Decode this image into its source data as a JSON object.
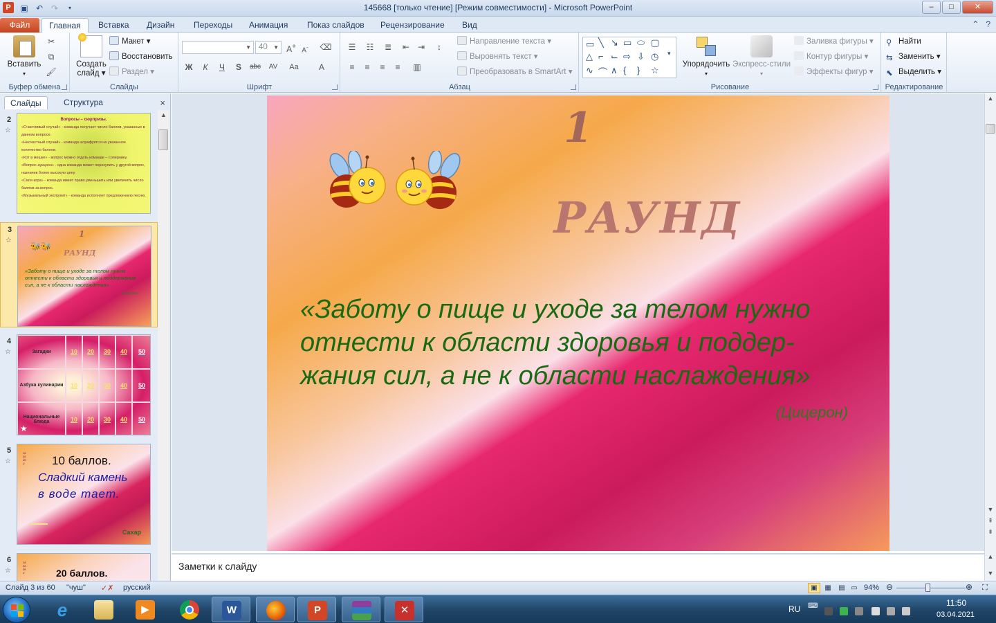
{
  "window": {
    "title": "145668 [только чтение] [Режим совместимости]  -  Microsoft PowerPoint",
    "app_icon": "P",
    "qat": [
      "save-icon",
      "undo-icon",
      "redo-icon"
    ],
    "controls": [
      "–",
      "□",
      "✕"
    ]
  },
  "tabs": {
    "file": "Файл",
    "items": [
      "Главная",
      "Вставка",
      "Дизайн",
      "Переходы",
      "Анимация",
      "Показ слайдов",
      "Рецензирование",
      "Вид"
    ],
    "active_index": 0
  },
  "ribbon": {
    "clipboard": {
      "label": "Буфер обмена",
      "paste": "Вставить"
    },
    "slides": {
      "label": "Слайды",
      "new_slide_line1": "Создать",
      "new_slide_line2": "слайд",
      "layout": "Макет",
      "reset": "Восстановить",
      "section": "Раздел"
    },
    "font": {
      "label": "Шрифт",
      "font_name": "",
      "font_size": "40",
      "grow": "A",
      "shrink": "A",
      "bold": "Ж",
      "italic": "К",
      "underline": "Ч",
      "shadow": "S",
      "strike": "abc",
      "spacing": "AV",
      "case": "Aa",
      "color": "A"
    },
    "paragraph": {
      "label": "Абзац",
      "text_direction": "Направление текста",
      "align_text": "Выровнять текст",
      "smartart": "Преобразовать в SmartArt"
    },
    "drawing": {
      "label": "Рисование",
      "arrange": "Упорядочить",
      "quick_styles": "Экспресс-стили",
      "fill": "Заливка фигуры",
      "outline": "Контур фигуры",
      "effects": "Эффекты фигур"
    },
    "editing": {
      "label": "Редактирование",
      "find": "Найти",
      "replace": "Заменить",
      "select": "Выделить"
    }
  },
  "left_panel": {
    "tab_slides": "Слайды",
    "tab_outline": "Структура",
    "close": "×",
    "thumbnails": [
      {
        "number": "2",
        "lines": [
          "Вопросы – сюрпризы.",
          "«Счастливый случай» - команда получает число баллов, указанных в данном вопросе.",
          "«Несчастный случай» - команда штрафуется на указанное количество баллов.",
          "«Кот в мешке» - вопрос можно отдать команде – сопернику.",
          "«Вопрос-аукцион» - одна команда может перекупить у другой вопрос, назначив более высокую цену.",
          "«Своя игра» - команда имеет право уменьшить или увеличить число баллов за вопрос.",
          "«Музыкальный экспромт» - команда исполняет предложенную песню."
        ]
      },
      {
        "number": "3",
        "title_num": "1",
        "title": "РАУНД",
        "quote": "«Заботу о пище и уходе за телом нужно отнести к области здоровья и поддержания сил, а не к области наслаждения»",
        "author": "(Цицерон)"
      },
      {
        "number": "4",
        "rows": [
          {
            "label": "Загадки",
            "cells": [
              "10",
              "20",
              "30",
              "40",
              "50"
            ]
          },
          {
            "label": "Азбука кулинарии",
            "cells": [
              "10",
              "20",
              "30",
              "40",
              "50"
            ]
          },
          {
            "label": "Национальные блюда",
            "cells": [
              "10",
              "20",
              "30",
              "40",
              "50"
            ]
          }
        ]
      },
      {
        "number": "5",
        "side": "загадки",
        "points": "10 баллов.",
        "riddle_line1": "Сладкий камень",
        "riddle_line2": "в воде тает.",
        "answer": "Сахар"
      },
      {
        "number": "6",
        "side": "загадки",
        "points": "20 баллов."
      }
    ]
  },
  "slide": {
    "number": "1",
    "title": "РАУНД",
    "quote": "«Заботу о пище и уходе за телом нужно отнести к области здоровья и поддер-жания сил, а не к области наслаждения»",
    "quote_lines": [
      "«Заботу о пище и уходе за телом нужно",
      "отнести к области здоровья и поддер-",
      "жания сил, а не к области наслаждения»"
    ],
    "author": "(Цицерон)"
  },
  "notes": {
    "placeholder": "Заметки к слайду"
  },
  "status": {
    "slide_info": "Слайд 3 из 60",
    "theme": "\"чуш\"",
    "language": "русский",
    "zoom": "94%"
  },
  "taskbar": {
    "apps": [
      "ie-icon",
      "explorer-icon",
      "media-player-icon",
      "chrome-icon",
      "word-icon",
      "firefox-icon",
      "powerpoint-icon",
      "winrar-icon",
      "pdf-icon"
    ],
    "lang": "RU",
    "time": "11:50",
    "date": "03.04.2021"
  },
  "colors": {
    "quote": "#196a13",
    "title": "#b9766f",
    "file_tab": "#c44520",
    "ribbon": "#e3ecf7"
  }
}
